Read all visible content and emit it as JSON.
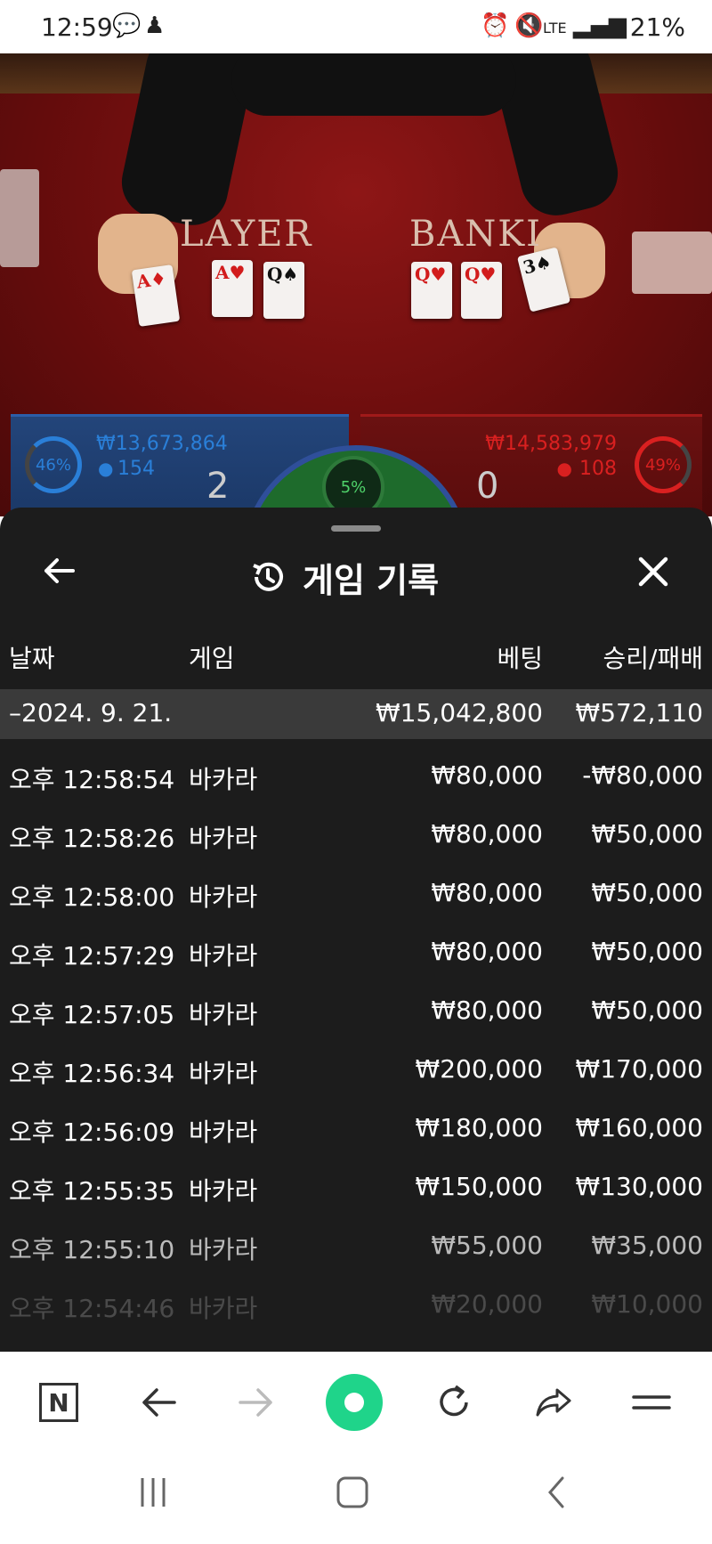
{
  "status_bar": {
    "time": "12:59",
    "battery": "21%",
    "network": "LTE"
  },
  "game": {
    "player_label": "LAYER",
    "banker_label": "BANKI",
    "player": {
      "percent": "46%",
      "amount": "₩13,673,864",
      "count": "154",
      "score": "2"
    },
    "banker": {
      "percent": "49%",
      "amount": "₩14,583,979",
      "count": "108",
      "score": "0"
    },
    "tie_percent": "5%",
    "colors": {
      "player": "#2a7fd8",
      "banker": "#d92020",
      "tie": "#4fd26a"
    }
  },
  "sheet": {
    "title": "게임 기록",
    "columns": {
      "date": "날짜",
      "game": "게임",
      "bet": "베팅",
      "result": "승리/패배"
    },
    "group": {
      "date": "–2024. 9. 21.",
      "bet_total": "₩15,042,800",
      "result_total": "₩572,110"
    },
    "rows": [
      {
        "time": "오후 12:58:54",
        "game": "바카라",
        "bet": "₩80,000",
        "result": "-₩80,000"
      },
      {
        "time": "오후 12:58:26",
        "game": "바카라",
        "bet": "₩80,000",
        "result": "₩50,000"
      },
      {
        "time": "오후 12:58:00",
        "game": "바카라",
        "bet": "₩80,000",
        "result": "₩50,000"
      },
      {
        "time": "오후 12:57:29",
        "game": "바카라",
        "bet": "₩80,000",
        "result": "₩50,000"
      },
      {
        "time": "오후 12:57:05",
        "game": "바카라",
        "bet": "₩80,000",
        "result": "₩50,000"
      },
      {
        "time": "오후 12:56:34",
        "game": "바카라",
        "bet": "₩200,000",
        "result": "₩170,000"
      },
      {
        "time": "오후 12:56:09",
        "game": "바카라",
        "bet": "₩180,000",
        "result": "₩160,000"
      },
      {
        "time": "오후 12:55:35",
        "game": "바카라",
        "bet": "₩150,000",
        "result": "₩130,000"
      },
      {
        "time": "오후 12:55:10",
        "game": "바카라",
        "bet": "₩55,000",
        "result": "₩35,000"
      },
      {
        "time": "오후 12:54:46",
        "game": "바카라",
        "bet": "₩20,000",
        "result": "₩10,000"
      }
    ]
  },
  "browser": {
    "n_label": "N"
  }
}
